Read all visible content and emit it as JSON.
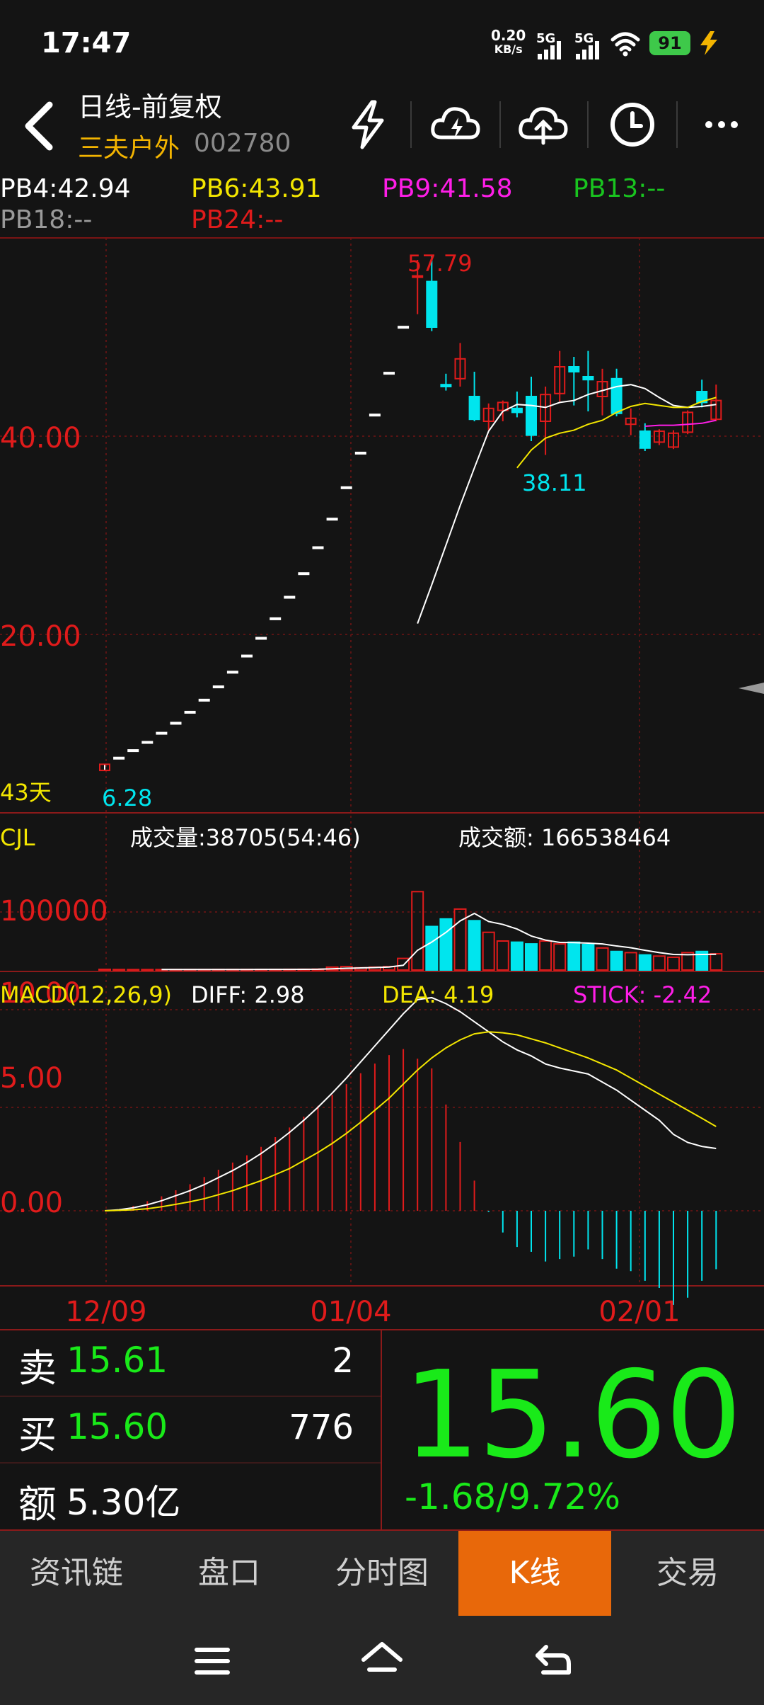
{
  "status_bar": {
    "time": "17:47",
    "net_rate_value": "0.20",
    "net_rate_unit": "KB/s",
    "sim1": "5G",
    "sim2": "5G",
    "battery": "91"
  },
  "header": {
    "title": "日线-前复权",
    "stock_name": "三夫户外",
    "stock_code": "002780"
  },
  "ma_row": {
    "pb4": "PB4:42.94",
    "pb6": "PB6:43.91",
    "pb9": "PB9:41.58",
    "pb13": "PB13:--",
    "pb18": "PB18:--",
    "pb24": "PB24:--"
  },
  "colors": {
    "up": "#e01b1b",
    "down": "#00e5ee",
    "green": "#19ea19",
    "yellow": "#f3e600",
    "magenta": "#ff1ee8",
    "accent_tab": "#e8680a"
  },
  "chart_data": {
    "type": "candlestick",
    "price_axis_labels": [
      "40.00",
      "20.00"
    ],
    "high_label": "57.79",
    "low_label": "38.11",
    "start_label": "6.28",
    "days_label": "43天",
    "date_labels": [
      "12/09",
      "01/04",
      "02/01"
    ],
    "volume": {
      "name": "CJL",
      "vol_text": "成交量:38705(54:46)",
      "amount_text": "成交额: 166538464",
      "axis_label": "100000"
    },
    "macd": {
      "name": "MACD(12,26,9)",
      "diff_text": "DIFF: 2.98",
      "dea_text": "DEA: 4.19",
      "stick_text": "STICK: -2.42",
      "axis_labels": [
        "10.00",
        "5.00",
        "0.00"
      ]
    },
    "candles": [
      {
        "o": 6.28,
        "h": 6.9,
        "l": 6.28,
        "c": 6.9,
        "v": 1200
      },
      {
        "o": 7.59,
        "h": 7.59,
        "l": 7.59,
        "c": 7.59,
        "v": 900
      },
      {
        "o": 8.35,
        "h": 8.35,
        "l": 8.35,
        "c": 8.35,
        "v": 800
      },
      {
        "o": 9.18,
        "h": 9.18,
        "l": 9.18,
        "c": 9.18,
        "v": 800
      },
      {
        "o": 10.1,
        "h": 10.1,
        "l": 10.1,
        "c": 10.1,
        "v": 800
      },
      {
        "o": 11.11,
        "h": 11.11,
        "l": 11.11,
        "c": 11.11,
        "v": 900
      },
      {
        "o": 12.22,
        "h": 12.22,
        "l": 12.22,
        "c": 12.22,
        "v": 900
      },
      {
        "o": 13.44,
        "h": 13.44,
        "l": 13.44,
        "c": 13.44,
        "v": 900
      },
      {
        "o": 14.78,
        "h": 14.78,
        "l": 14.78,
        "c": 14.78,
        "v": 1000
      },
      {
        "o": 16.26,
        "h": 16.26,
        "l": 16.26,
        "c": 16.26,
        "v": 1000
      },
      {
        "o": 17.89,
        "h": 17.89,
        "l": 17.89,
        "c": 17.89,
        "v": 1100
      },
      {
        "o": 19.68,
        "h": 19.68,
        "l": 19.68,
        "c": 19.68,
        "v": 1100
      },
      {
        "o": 21.65,
        "h": 21.65,
        "l": 21.65,
        "c": 21.65,
        "v": 1200
      },
      {
        "o": 23.82,
        "h": 23.82,
        "l": 23.82,
        "c": 23.82,
        "v": 1300
      },
      {
        "o": 26.2,
        "h": 26.2,
        "l": 26.2,
        "c": 26.2,
        "v": 1400
      },
      {
        "o": 28.82,
        "h": 28.82,
        "l": 28.82,
        "c": 28.82,
        "v": 1600
      },
      {
        "o": 31.7,
        "h": 31.7,
        "l": 31.7,
        "c": 31.7,
        "v": 5000
      },
      {
        "o": 34.87,
        "h": 34.87,
        "l": 34.87,
        "c": 34.87,
        "v": 6000
      },
      {
        "o": 38.36,
        "h": 38.36,
        "l": 38.36,
        "c": 38.36,
        "v": 4000
      },
      {
        "o": 42.2,
        "h": 42.2,
        "l": 42.2,
        "c": 42.2,
        "v": 5000
      },
      {
        "o": 46.42,
        "h": 46.42,
        "l": 46.42,
        "c": 46.42,
        "v": 6000
      },
      {
        "o": 51.06,
        "h": 51.06,
        "l": 51.06,
        "c": 51.06,
        "v": 20000
      },
      {
        "o": 56.17,
        "h": 57.79,
        "l": 52.3,
        "c": 56.17,
        "v": 135000
      },
      {
        "o": 55.6,
        "h": 58.3,
        "l": 50.6,
        "c": 51.0,
        "v": 75000
      },
      {
        "o": 45.2,
        "h": 46.3,
        "l": 44.6,
        "c": 45.0,
        "v": 88000
      },
      {
        "o": 45.8,
        "h": 49.4,
        "l": 45.0,
        "c": 47.8,
        "v": 105000
      },
      {
        "o": 44.0,
        "h": 46.5,
        "l": 41.5,
        "c": 41.7,
        "v": 85000
      },
      {
        "o": 41.5,
        "h": 43.3,
        "l": 40.6,
        "c": 42.8,
        "v": 65000
      },
      {
        "o": 42.6,
        "h": 43.6,
        "l": 41.5,
        "c": 43.4,
        "v": 50000
      },
      {
        "o": 42.8,
        "h": 44.5,
        "l": 41.9,
        "c": 42.4,
        "v": 48000
      },
      {
        "o": 44.0,
        "h": 46.0,
        "l": 39.5,
        "c": 40.1,
        "v": 45000
      },
      {
        "o": 41.5,
        "h": 45.0,
        "l": 38.11,
        "c": 44.2,
        "v": 50000
      },
      {
        "o": 44.3,
        "h": 48.6,
        "l": 43.5,
        "c": 47.0,
        "v": 45000
      },
      {
        "o": 47.0,
        "h": 48.0,
        "l": 43.1,
        "c": 46.5,
        "v": 48000
      },
      {
        "o": 46.0,
        "h": 48.6,
        "l": 42.5,
        "c": 45.7,
        "v": 44000
      },
      {
        "o": 44.0,
        "h": 46.8,
        "l": 42.1,
        "c": 45.5,
        "v": 38000
      },
      {
        "o": 45.8,
        "h": 46.8,
        "l": 42.0,
        "c": 42.3,
        "v": 32000
      },
      {
        "o": 41.2,
        "h": 42.8,
        "l": 40.1,
        "c": 41.8,
        "v": 30000
      },
      {
        "o": 40.5,
        "h": 41.3,
        "l": 38.5,
        "c": 38.8,
        "v": 26000
      },
      {
        "o": 39.4,
        "h": 40.7,
        "l": 39.1,
        "c": 40.5,
        "v": 24000
      },
      {
        "o": 38.9,
        "h": 40.6,
        "l": 38.7,
        "c": 40.3,
        "v": 22000
      },
      {
        "o": 40.4,
        "h": 42.6,
        "l": 40.2,
        "c": 42.4,
        "v": 30000
      },
      {
        "o": 44.5,
        "h": 45.7,
        "l": 42.9,
        "c": 43.4,
        "v": 32000
      },
      {
        "o": 41.7,
        "h": 45.2,
        "l": 41.5,
        "c": 43.6,
        "v": 28000
      }
    ],
    "ma_lines": [
      {
        "name": "white",
        "color": "#ffffff",
        "values": [
          null,
          null,
          null,
          null,
          null,
          null,
          null,
          null,
          null,
          null,
          null,
          null,
          null,
          null,
          null,
          null,
          null,
          null,
          null,
          null,
          null,
          null,
          21.1,
          25.0,
          29.0,
          33.0,
          36.8,
          40.5,
          42.5,
          43.2,
          43.1,
          42.9,
          43.4,
          43.6,
          44.2,
          44.6,
          45.0,
          45.2,
          44.8,
          43.9,
          43.1,
          42.9,
          43.0,
          43.2
        ]
      },
      {
        "name": "yellow",
        "color": "#f3e600",
        "values": [
          null,
          null,
          null,
          null,
          null,
          null,
          null,
          null,
          null,
          null,
          null,
          null,
          null,
          null,
          null,
          null,
          null,
          null,
          null,
          null,
          null,
          null,
          null,
          null,
          null,
          null,
          null,
          null,
          null,
          36.8,
          38.6,
          39.8,
          40.3,
          40.6,
          41.2,
          41.6,
          42.4,
          43.0,
          43.3,
          43.1,
          42.9,
          42.9,
          43.5,
          43.9
        ]
      },
      {
        "name": "magenta",
        "color": "#ff1ee8",
        "values": [
          null,
          null,
          null,
          null,
          null,
          null,
          null,
          null,
          null,
          null,
          null,
          null,
          null,
          null,
          null,
          null,
          null,
          null,
          null,
          null,
          null,
          null,
          null,
          null,
          null,
          null,
          null,
          null,
          null,
          null,
          null,
          null,
          null,
          null,
          null,
          null,
          null,
          null,
          41.0,
          41.1,
          41.1,
          41.2,
          41.3,
          41.6
        ]
      }
    ],
    "macd_series": {
      "diff": [
        0,
        0.05,
        0.15,
        0.3,
        0.5,
        0.75,
        1.0,
        1.3,
        1.65,
        2.0,
        2.4,
        2.85,
        3.35,
        3.9,
        4.5,
        5.15,
        5.85,
        6.6,
        7.4,
        8.2,
        9.0,
        9.8,
        10.5,
        10.6,
        10.3,
        9.9,
        9.4,
        8.9,
        8.4,
        8.0,
        7.7,
        7.3,
        7.1,
        6.95,
        6.8,
        6.4,
        6.0,
        5.5,
        5.0,
        4.5,
        3.8,
        3.4,
        3.2,
        3.1
      ],
      "dea": [
        0,
        0.02,
        0.05,
        0.1,
        0.2,
        0.32,
        0.45,
        0.6,
        0.8,
        1.0,
        1.25,
        1.5,
        1.8,
        2.1,
        2.5,
        2.9,
        3.35,
        3.85,
        4.4,
        5.0,
        5.6,
        6.3,
        7.0,
        7.6,
        8.1,
        8.5,
        8.8,
        8.9,
        8.85,
        8.75,
        8.55,
        8.35,
        8.1,
        7.85,
        7.6,
        7.3,
        7.0,
        6.6,
        6.2,
        5.8,
        5.4,
        5.0,
        4.6,
        4.19
      ],
      "stick": [
        0,
        0.05,
        0.2,
        0.4,
        0.6,
        0.85,
        1.1,
        1.4,
        1.7,
        2.0,
        2.3,
        2.65,
        3.05,
        3.45,
        3.9,
        4.35,
        4.8,
        5.25,
        5.7,
        6.1,
        6.45,
        6.7,
        6.3,
        5.9,
        4.4,
        2.85,
        1.25,
        -0.05,
        -0.9,
        -1.5,
        -1.7,
        -2.1,
        -2.0,
        -1.9,
        -1.6,
        -2.0,
        -2.4,
        -2.5,
        -2.9,
        -3.2,
        -3.9,
        -3.6,
        -2.9,
        -2.42
      ]
    }
  },
  "quote": {
    "sell_label": "卖",
    "sell_price": "15.61",
    "sell_qty": "2",
    "buy_label": "买",
    "buy_price": "15.60",
    "buy_qty": "776",
    "amount_label": "额",
    "amount_value": "5.30亿",
    "last_price": "15.60",
    "change": "-1.68/9.72%"
  },
  "tabs": [
    {
      "label": "资讯链"
    },
    {
      "label": "盘口"
    },
    {
      "label": "分时图"
    },
    {
      "label": "K线"
    },
    {
      "label": "交易"
    }
  ]
}
